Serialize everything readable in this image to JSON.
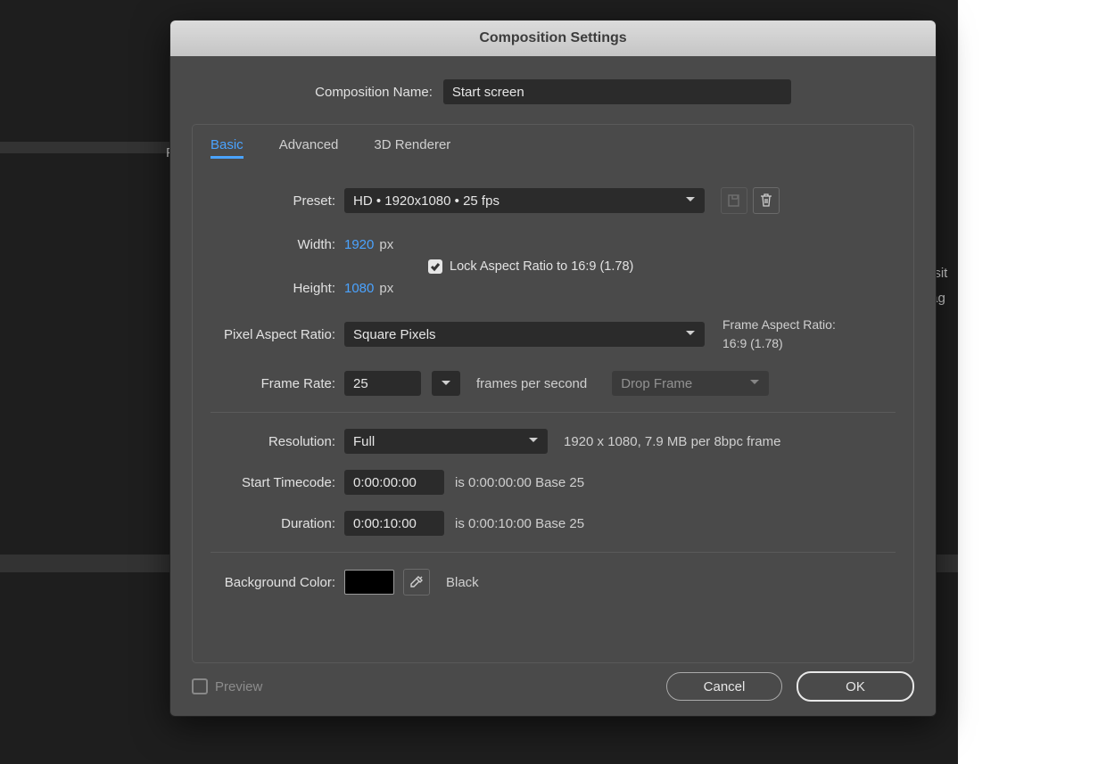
{
  "dialog": {
    "title": "Composition Settings",
    "name_label": "Composition Name:",
    "name_value": "Start screen",
    "tabs": [
      "Basic",
      "Advanced",
      "3D Renderer"
    ],
    "active_tab": 0
  },
  "preset": {
    "label": "Preset:",
    "value": "HD  •  1920x1080 • 25 fps"
  },
  "dimensions": {
    "width_label": "Width:",
    "width_value": "1920",
    "height_label": "Height:",
    "height_value": "1080",
    "unit": "px",
    "lock_label": "Lock Aspect Ratio to 16:9 (1.78)",
    "lock_checked": true
  },
  "par": {
    "label": "Pixel Aspect Ratio:",
    "value": "Square Pixels",
    "frame_label": "Frame Aspect Ratio:",
    "frame_value": "16:9 (1.78)"
  },
  "fps": {
    "label": "Frame Rate:",
    "value": "25",
    "suffix": "frames per second",
    "drop_value": "Drop Frame"
  },
  "resolution": {
    "label": "Resolution:",
    "value": "Full",
    "info": "1920 x 1080, 7.9 MB per 8bpc frame"
  },
  "timecode": {
    "start_label": "Start Timecode:",
    "start_value": "0:00:00:00",
    "start_info": "is 0:00:00:00  Base 25",
    "dur_label": "Duration:",
    "dur_value": "0:00:10:00",
    "dur_info": "is 0:00:10:00  Base 25"
  },
  "bg": {
    "label": "Background Color:",
    "name": "Black",
    "value": "#000000"
  },
  "footer": {
    "preview": "Preview",
    "cancel": "Cancel",
    "ok": "OK"
  },
  "back": {
    "txt1": "F",
    "txt2": "osit",
    "txt3": "tag"
  }
}
